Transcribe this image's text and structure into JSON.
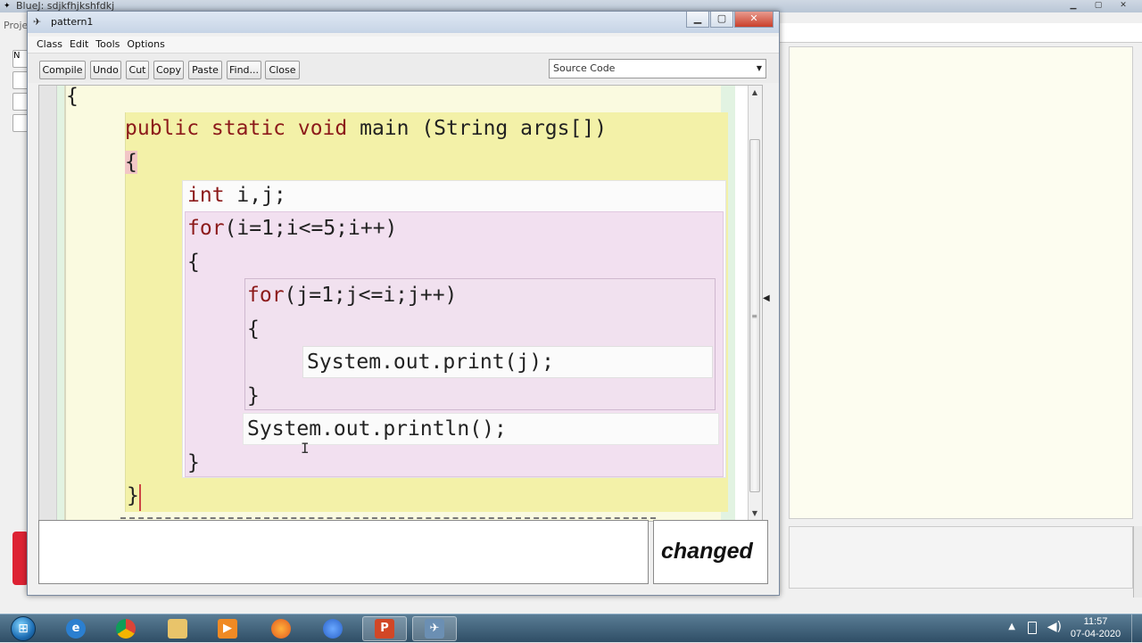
{
  "background_window": {
    "title": "BlueJ:  sdjkfhjkshfdkj",
    "project_label": "Proje"
  },
  "editor": {
    "title": "pattern1",
    "menu": [
      "Class",
      "Edit",
      "Tools",
      "Options"
    ],
    "toolbar": {
      "compile": "Compile",
      "undo": "Undo",
      "cut": "Cut",
      "copy": "Copy",
      "paste": "Paste",
      "find": "Find...",
      "close": "Close"
    },
    "view_select": {
      "value": "Source Code"
    },
    "code": {
      "line_class_brace": "{",
      "line_method_sig_kw": "public static void",
      "line_method_sig_rest": " main (String args[])",
      "line_method_open": "{",
      "line_decl_kw": "int",
      "line_decl_rest": " i,j;",
      "line_for_outer_kw": "for",
      "line_for_outer_rest": "(i=1;i<=5;i++)",
      "line_outer_open": "{",
      "line_for_inner_kw": "for",
      "line_for_inner_rest": "(j=1;j<=i;j++)",
      "line_inner_open": "{",
      "line_print": "System.out.print(j);",
      "line_inner_close": "}",
      "line_println": "System.out.println();",
      "line_outer_close": "}",
      "line_method_close": "}"
    },
    "status": "changed",
    "message": ""
  },
  "taskbar": {
    "start_label": "⊞",
    "time": "11:57",
    "date": "07-04-2020"
  },
  "colors": {
    "keyword": "#8c1a1a",
    "class_scope": "#e2f3e2",
    "method_scope": "#f3f1a8",
    "loop_scope": "#f2e0f0"
  }
}
